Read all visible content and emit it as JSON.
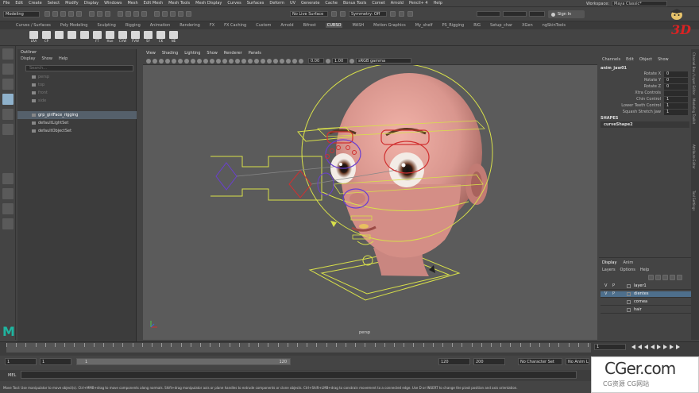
{
  "menubar": {
    "items": [
      "File",
      "Edit",
      "Create",
      "Select",
      "Modify",
      "Display",
      "Windows",
      "Mesh",
      "Edit Mesh",
      "Mesh Tools",
      "Mesh Display",
      "Curves",
      "Surfaces",
      "Deform",
      "UV",
      "Generate",
      "Cache",
      "Bonus Tools",
      "Comet",
      "Arnold",
      "Pencil+ 4",
      "Help"
    ],
    "workspace_label": "Workspace:",
    "workspace_value": "Maya Classic*"
  },
  "statusline": {
    "mode": "Modeling",
    "live_surface": "No Live Surface",
    "symmetry": "Symmetry: Off",
    "sign_in": "Sign In"
  },
  "shelf": {
    "tabs": [
      "Curves / Surfaces",
      "Poly Modeling",
      "Sculpting",
      "Rigging",
      "Animation",
      "Rendering",
      "FX",
      "FX Caching",
      "Custom",
      "Arnold",
      "Bifrost",
      "CURSO",
      "MASH",
      "Motion Graphics",
      "My_shelf",
      "PS_Rigging",
      "RIG",
      "Setup_char",
      "XGen",
      "ngSkinTools"
    ],
    "active_tab": "CURSO",
    "buttons": [
      "LRA",
      "CP",
      "",
      "",
      "",
      "FT",
      "Hue",
      "CVW",
      "FVW",
      "SY",
      "CK",
      "NE"
    ]
  },
  "brand": {
    "logo_text": "3D"
  },
  "outliner": {
    "title": "Outliner",
    "menu": [
      "Display",
      "Show",
      "Help"
    ],
    "search_placeholder": "Search...",
    "items": [
      {
        "label": "persp",
        "dim": true
      },
      {
        "label": "top",
        "dim": true
      },
      {
        "label": "front",
        "dim": true
      },
      {
        "label": "side",
        "dim": true
      },
      {
        "label": "grp_girlFace_rigging",
        "dim": false,
        "selected": true
      },
      {
        "label": "defaultLightSet",
        "dim": false
      },
      {
        "label": "defaultObjectSet",
        "dim": false
      }
    ]
  },
  "viewport": {
    "menu": [
      "View",
      "Shading",
      "Lighting",
      "Show",
      "Renderer",
      "Panels"
    ],
    "exposure": "0.00",
    "gamma": "1.00",
    "color_space": "sRGB gamma",
    "camera_label": "persp"
  },
  "channel_box": {
    "menu": [
      "Channels",
      "Edit",
      "Object",
      "Show"
    ],
    "object_name": "anim_jaw01",
    "attributes": [
      {
        "name": "Rotate X",
        "value": "0"
      },
      {
        "name": "Rotate Y",
        "value": "0"
      },
      {
        "name": "Rotate Z",
        "value": "0"
      },
      {
        "name": "Xtra Controls",
        "value": ""
      },
      {
        "name": "Chin Control",
        "value": "1"
      },
      {
        "name": "Lower Teeth Control",
        "value": "1"
      },
      {
        "name": "Squash Stretch Jaw",
        "value": "1"
      }
    ],
    "shapes_header": "SHAPES",
    "shape_name": "curveShape2"
  },
  "side_tabs": [
    "Channel Box / Layer Editor",
    "Modeling Toolkit",
    "Attribute Editor",
    "Tool Settings"
  ],
  "layers": {
    "tabs": [
      "Display",
      "Anim"
    ],
    "menu": [
      "Layers",
      "Options",
      "Help"
    ],
    "rows": [
      {
        "v": "V",
        "p": "P",
        "name": "layer1",
        "selected": false
      },
      {
        "v": "V",
        "p": "P",
        "name": "dientes",
        "selected": true
      },
      {
        "v": "",
        "p": "",
        "name": "cornea",
        "selected": false
      },
      {
        "v": "",
        "p": "",
        "name": "hair",
        "selected": false
      }
    ]
  },
  "timeline": {
    "current_frame": "1"
  },
  "range": {
    "start": "1",
    "inner_start": "1",
    "slider_start": "1",
    "slider_end": "120",
    "inner_end": "120",
    "end": "200",
    "character_set": "No Character Set",
    "anim_layer": "No Anim Layer"
  },
  "mel": {
    "label": "MEL"
  },
  "help_line": "Move Tool: Use manipulator to move object(s). Ctrl+MMB+drag to move components along normals. Shift+drag manipulator axis or plane handles to extrude components or clone objects. Ctrl+Shift+LMB+drag to constrain movement to a connected edge. Use D or INSERT to change the pivot position and axis orientation.",
  "watermark": {
    "main": "CGer.com",
    "sub": "CG资源 CG网站"
  },
  "colors": {
    "skin": "#d9968e",
    "control_yellow": "#d8e04a",
    "control_purple": "#6a3fd0",
    "control_red": "#d03030",
    "selection_blue": "#4e6f8c",
    "maya_teal": "#1fb5a0"
  }
}
